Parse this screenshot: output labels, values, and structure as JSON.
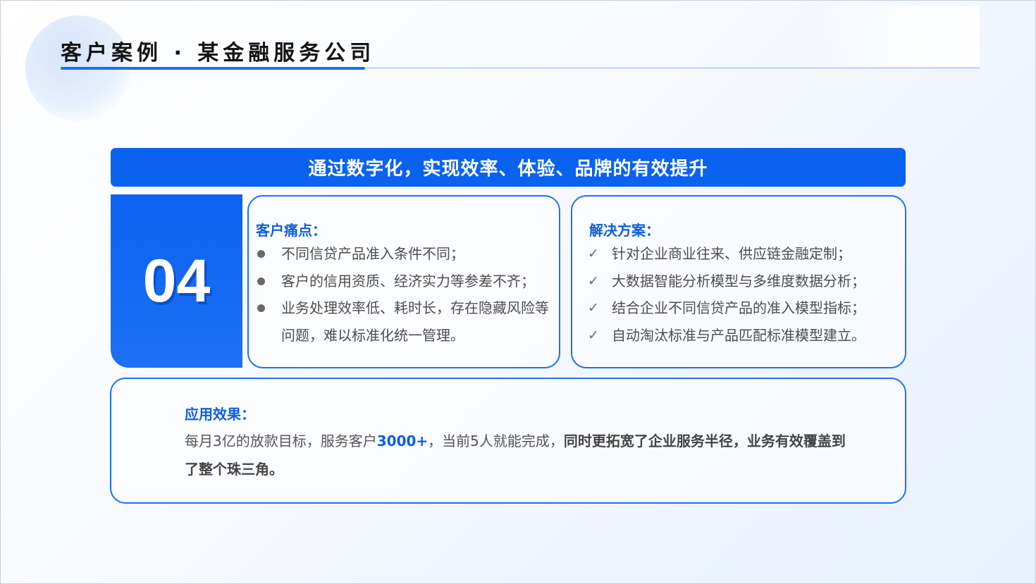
{
  "page": {
    "title": "客户案例 · 某金融服务公司"
  },
  "banner": {
    "text": "通过数字化，实现效率、体验、品牌的有效提升"
  },
  "case_number": "04",
  "pain_points": {
    "heading": "客户痛点：",
    "items": [
      "不同信贷产品准入条件不同；",
      "客户的信用资质、经济实力等参差不齐；",
      "业务处理效率低、耗时长，存在隐藏风险等问题，难以标准化统一管理。"
    ]
  },
  "solutions": {
    "heading": "解决方案：",
    "items": [
      "针对企业商业往来、供应链金融定制；",
      "大数据智能分析模型与多维度数据分析；",
      "结合企业不同信贷产品的准入模型指标；",
      "自动淘汰标准与产品匹配标准模型建立。"
    ]
  },
  "results": {
    "heading": "应用效果：",
    "text_part1": "每月3亿的放款目标，服务客户",
    "text_highlight": "3000+",
    "text_part2": "，当前5人就能完成，",
    "text_part3": "同时更拓宽了企业服务半径，业务有效覆盖到了整个珠三角。"
  },
  "colors": {
    "primary_blue": "#0a62f0",
    "heading_blue": "#0d5fe0",
    "card_border": "#1f6ff2",
    "body_text": "#4d4d4d"
  },
  "icons": {
    "bullet": "filled-circle-bullet",
    "check": "checkmark"
  }
}
